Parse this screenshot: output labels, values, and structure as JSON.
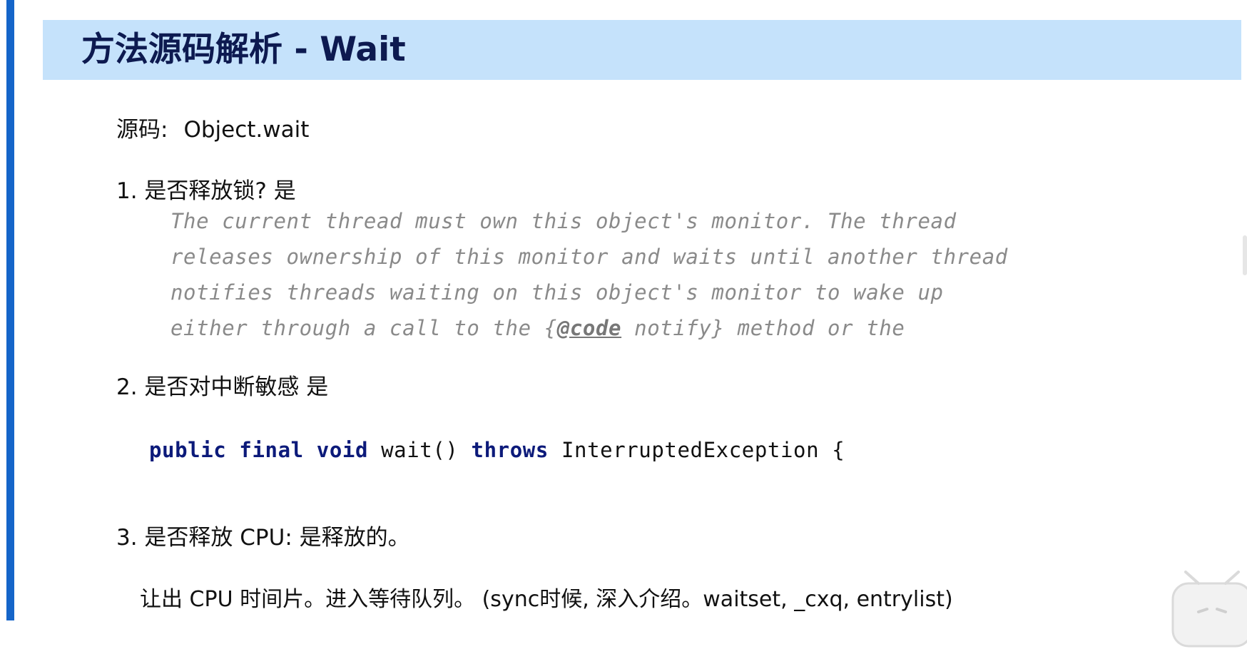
{
  "title": "方法源码解析 - Wait",
  "source": {
    "label": "源码:",
    "value": "Object.wait"
  },
  "q1": {
    "heading": "1. 是否释放锁? 是",
    "javadoc_lines": [
      "The current thread must own this object's monitor. The thread",
      "releases ownership of this monitor and waits until another thread",
      "notifies threads waiting on this object's monitor to wake up"
    ],
    "javadoc_last": {
      "before": "either through a call to the {",
      "tag": "@code",
      "after": " notify} method or the"
    }
  },
  "q2": {
    "heading": "2. 是否对中断敏感 是",
    "signature": {
      "kw1": "public",
      "kw2": "final",
      "kw3": "void",
      "method": "wait()",
      "kw4": "throws",
      "exception": "InterruptedException {"
    }
  },
  "q3": {
    "heading": "3. 是否释放 CPU: 是释放的。",
    "detail": "让出 CPU 时间片。进入等待队列。 (sync时候, 深入介绍。waitset, _cxq, entrylist)"
  },
  "colors": {
    "banner": "#c5e2fb",
    "title": "#0d1a50",
    "left_bar": "#1565c9",
    "keyword": "#0c1a7a",
    "javadoc": "#8a8a8a"
  },
  "icons": {
    "corner": "bilibili-tv-icon"
  }
}
